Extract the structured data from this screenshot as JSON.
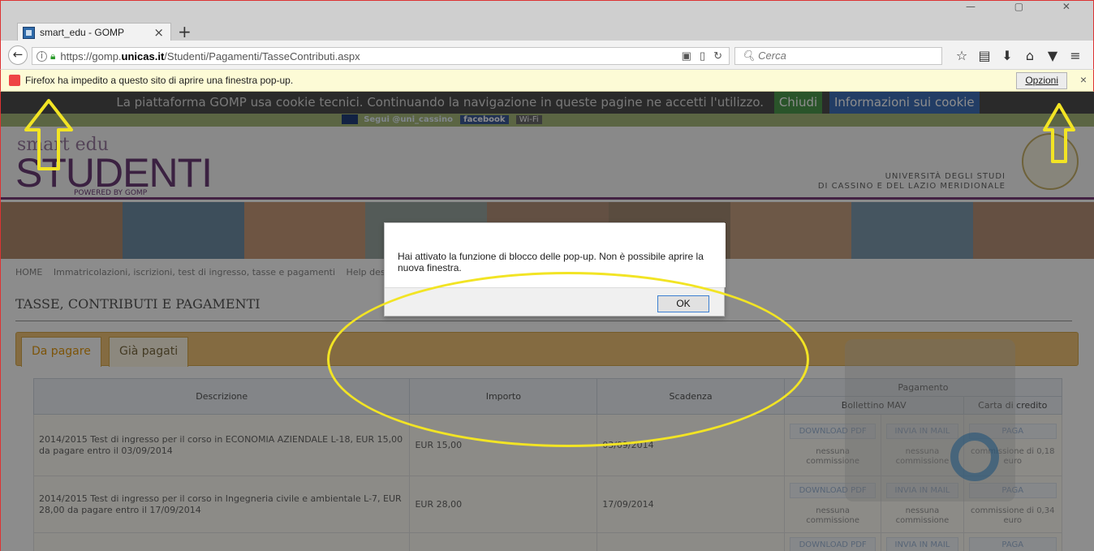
{
  "browser": {
    "tab_title": "smart_edu - GOMP",
    "tab_close": "×",
    "new_tab": "+",
    "url_prefix": "https://gomp.",
    "url_host": "unicas.it",
    "url_path": "/Studenti/Pagamenti/TasseContributi.aspx",
    "search_placeholder": "Cerca",
    "popup_message": "Firefox ha impedito a questo sito di aprire una finestra pop-up.",
    "popup_options": "Opzioni",
    "popup_close": "×"
  },
  "cookie": {
    "message": "La piattaforma GOMP usa cookie tecnici. Continuando la navigazione in queste pagine ne accetti l'utilizzo.",
    "close_label": "Chiudi",
    "info_label": "Informazioni sui cookie"
  },
  "social": {
    "twitter": "Segui @uni_cassino",
    "facebook": "facebook",
    "wifi": "Wi-Fi"
  },
  "header": {
    "logo_top": "smart edu",
    "logo_main": "STUDENTI",
    "logo_powered": "POWERED BY GOMP",
    "uni_line1": "UNIVERSITÀ DEGLI STUDI",
    "uni_line2": "DI CASSINO E DEL LAZIO MERIDIONALE"
  },
  "breadcrumb": {
    "home": "HOME",
    "section": "Immatricolazioni, iscrizioni, test di ingresso, tasse e pagamenti",
    "help": "Help desk"
  },
  "page_title": "TASSE, CONTRIBUTI E PAGAMENTI",
  "tabs": {
    "to_pay": "Da pagare",
    "paid": "Già pagati"
  },
  "table": {
    "col_description": "Descrizione",
    "col_amount": "Importo",
    "col_due": "Scadenza",
    "col_payment": "Pagamento",
    "col_mav": "Bollettino MAV",
    "col_card": "Carta di credito",
    "btn_download": "DOWNLOAD PDF",
    "btn_mail": "INVIA IN MAIL",
    "btn_pay": "PAGA",
    "no_fee": "nessuna commissione",
    "rows": [
      {
        "description": "2014/2015 Test di ingresso per il corso in ECONOMIA AZIENDALE L-18, EUR 15,00 da pagare entro il 03/09/2014",
        "amount": "EUR 15,00",
        "due": "03/09/2014",
        "card_fee": "commissione di 0,18 euro"
      },
      {
        "description": "2014/2015 Test di ingresso per il corso in Ingegneria civile e ambientale L-7, EUR 28,00 da pagare entro il 17/09/2014",
        "amount": "EUR 28,00",
        "due": "17/09/2014",
        "card_fee": "commissione di 0,34 euro"
      }
    ]
  },
  "dialog": {
    "message": "Hai attivato la funzione di blocco delle pop-up. Non è possibile aprire la nuova finestra.",
    "ok_label": "OK"
  },
  "colors": {
    "annotation": "#f2e424",
    "brand_purple": "#6c3d77",
    "tab_orange": "#f0c477"
  }
}
